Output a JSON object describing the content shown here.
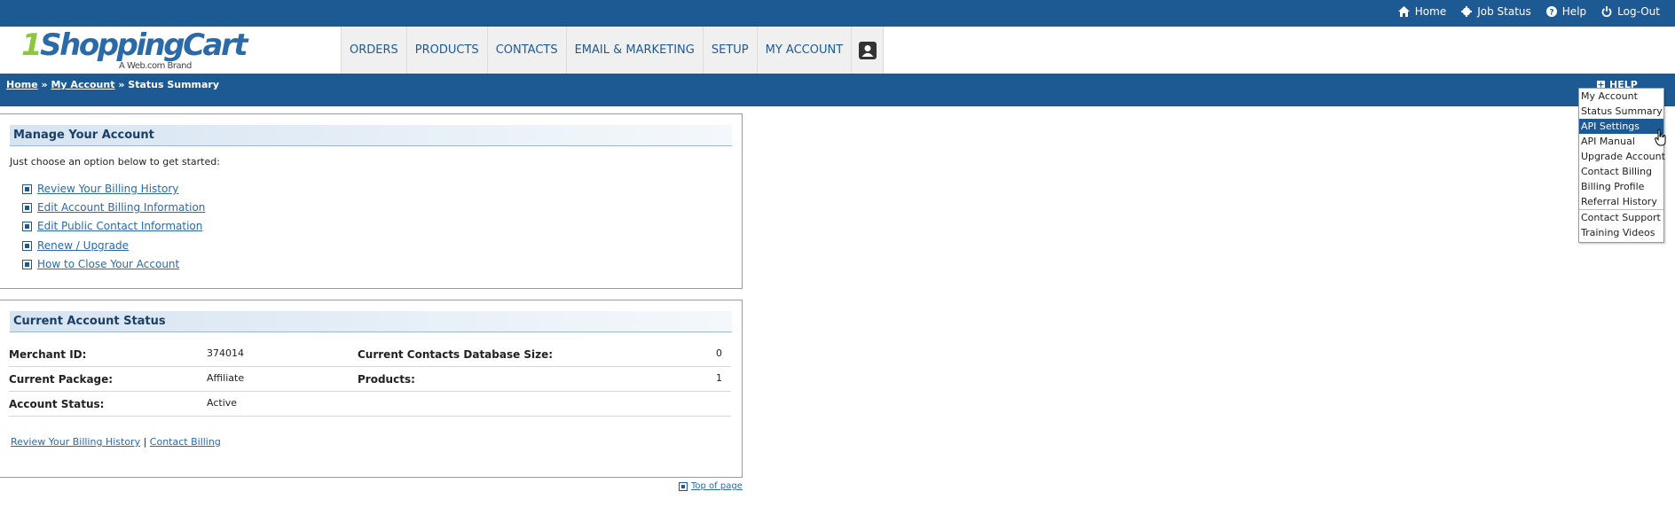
{
  "top_links": [
    {
      "label": "Home",
      "icon": "home-icon"
    },
    {
      "label": "Job Status",
      "icon": "gear-icon"
    },
    {
      "label": "Help",
      "icon": "help-icon"
    },
    {
      "label": "Log-Out",
      "icon": "power-icon"
    }
  ],
  "logo": {
    "first": "1",
    "main": "ShoppingCart",
    "sub": "A Web.com Brand"
  },
  "nav": [
    "ORDERS",
    "PRODUCTS",
    "CONTACTS",
    "EMAIL & MARKETING",
    "SETUP",
    "MY ACCOUNT"
  ],
  "breadcrumb": {
    "home": "Home",
    "sep": "»",
    "my_account": "My Account",
    "current": "Status Summary"
  },
  "help_label": "HELP",
  "manage": {
    "title": "Manage Your Account",
    "intro": "Just choose an option below to get started:",
    "links": [
      "Review Your Billing History",
      "Edit Account Billing Information",
      "Edit Public Contact Information",
      "Renew / Upgrade",
      "How to Close Your Account"
    ]
  },
  "status": {
    "title": "Current Account Status",
    "merchant_id_label": "Merchant ID:",
    "merchant_id": "374014",
    "package_label": "Current Package:",
    "package": "Affiliate",
    "account_status_label": "Account Status:",
    "account_status": "Active",
    "db_size_label": "Current Contacts Database Size:",
    "db_size": "0",
    "products_label": "Products:",
    "products": "1",
    "footer_link_1": "Review Your Billing History",
    "footer_sep": "|",
    "footer_link_2": "Contact Billing"
  },
  "top_of_page": "Top of page",
  "help_menu": {
    "group1": [
      "My Account",
      "Status Summary",
      "API Settings",
      "API Manual",
      "Upgrade Account",
      "Contact Billing",
      "Billing Profile",
      "Referral History"
    ],
    "group2": [
      "Contact Support",
      "Training Videos"
    ],
    "highlighted": "API Settings"
  },
  "colors": {
    "header_blue": "#1d5a93",
    "link_blue": "#2a6aa8",
    "logo_green": "#8dc63f"
  }
}
